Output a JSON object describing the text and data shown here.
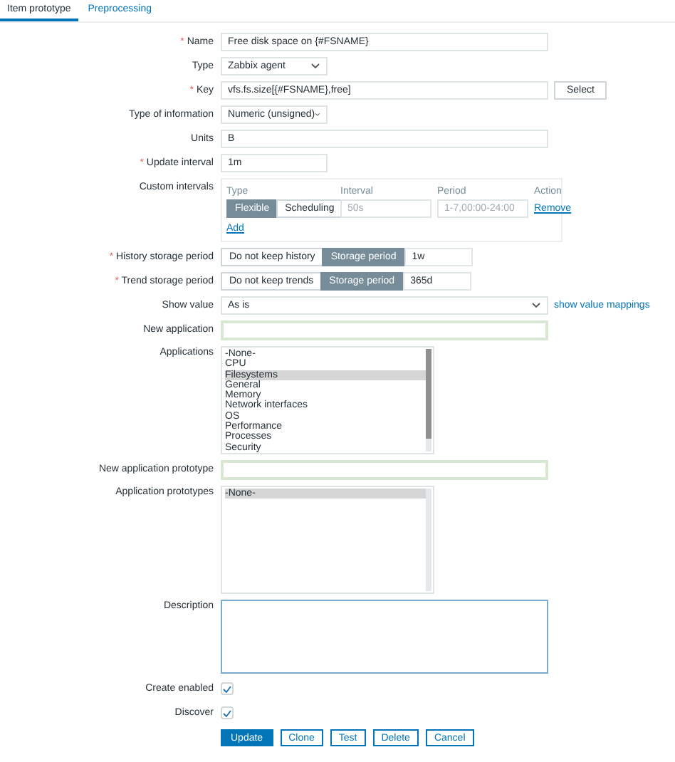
{
  "tabs": [
    {
      "label": "Item prototype",
      "selected": true
    },
    {
      "label": "Preprocessing",
      "selected": false
    }
  ],
  "fields": [
    {
      "kind": "text",
      "label": "Name",
      "mark": "*",
      "value": "Free disk space on {#FSNAME}"
    },
    {
      "kind": "select",
      "label": "Type",
      "value": "Zabbix agent"
    },
    {
      "kind": "text",
      "label": "Key",
      "mark": "*",
      "value": "vfs.fs.size[{#FSNAME},free]",
      "button": "Select"
    },
    {
      "kind": "select",
      "label": "Type of information",
      "value": "Numeric (unsigned)"
    },
    {
      "kind": "text",
      "label": "Units",
      "value": "B"
    },
    {
      "kind": "short-text",
      "label": "Update interval",
      "mark": "*",
      "value": "1m"
    },
    {
      "kind": "intervals",
      "label": "Custom intervals",
      "columns": [
        "Type",
        "Interval",
        "Period",
        "Action"
      ],
      "rows": [
        {
          "modes": [
            {
              "label": "Flexible",
              "selected": true
            },
            {
              "label": "Scheduling",
              "selected": false
            }
          ],
          "interval_placeholder": "50s",
          "period_placeholder": "1-7,00:00-24:00",
          "action": "Remove"
        }
      ],
      "add": "Add"
    },
    {
      "kind": "storage",
      "label": "History storage period",
      "mark": "*",
      "options": [
        {
          "label": "Do not keep history",
          "selected": false
        },
        {
          "label": "Storage period",
          "selected": true
        }
      ],
      "value": "1w"
    },
    {
      "kind": "storage",
      "label": "Trend storage period",
      "mark": "*",
      "options": [
        {
          "label": "Do not keep trends",
          "selected": false
        },
        {
          "label": "Storage period",
          "selected": true
        }
      ],
      "value": "365d"
    },
    {
      "kind": "wide-select",
      "label": "Show value",
      "value": "As is",
      "link": "show value mappings"
    },
    {
      "kind": "new-text",
      "label": "New application"
    },
    {
      "kind": "listbox",
      "label": "Applications",
      "options": [
        {
          "label": "-None-",
          "selected": false
        },
        {
          "label": "CPU",
          "selected": false
        },
        {
          "label": "Filesystems",
          "selected": true
        },
        {
          "label": "General",
          "selected": false
        },
        {
          "label": "Memory",
          "selected": false
        },
        {
          "label": "Network interfaces",
          "selected": false
        },
        {
          "label": "OS",
          "selected": false
        },
        {
          "label": "Performance",
          "selected": false
        },
        {
          "label": "Processes",
          "selected": false
        },
        {
          "label": "Security",
          "selected": false
        }
      ]
    },
    {
      "kind": "new-text",
      "label": "New application prototype"
    },
    {
      "kind": "listbox",
      "label": "Application prototypes",
      "options": [
        {
          "label": "-None-",
          "selected": true
        }
      ]
    },
    {
      "kind": "textarea",
      "label": "Description"
    },
    {
      "kind": "checkbox",
      "label": "Create enabled",
      "checked": true
    },
    {
      "kind": "checkbox",
      "label": "Discover",
      "checked": true
    }
  ],
  "buttons": [
    {
      "label": "Update",
      "primary": true
    },
    {
      "label": "Clone",
      "primary": false
    },
    {
      "label": "Test",
      "primary": false
    },
    {
      "label": "Delete",
      "primary": false
    },
    {
      "label": "Cancel",
      "primary": false
    }
  ]
}
